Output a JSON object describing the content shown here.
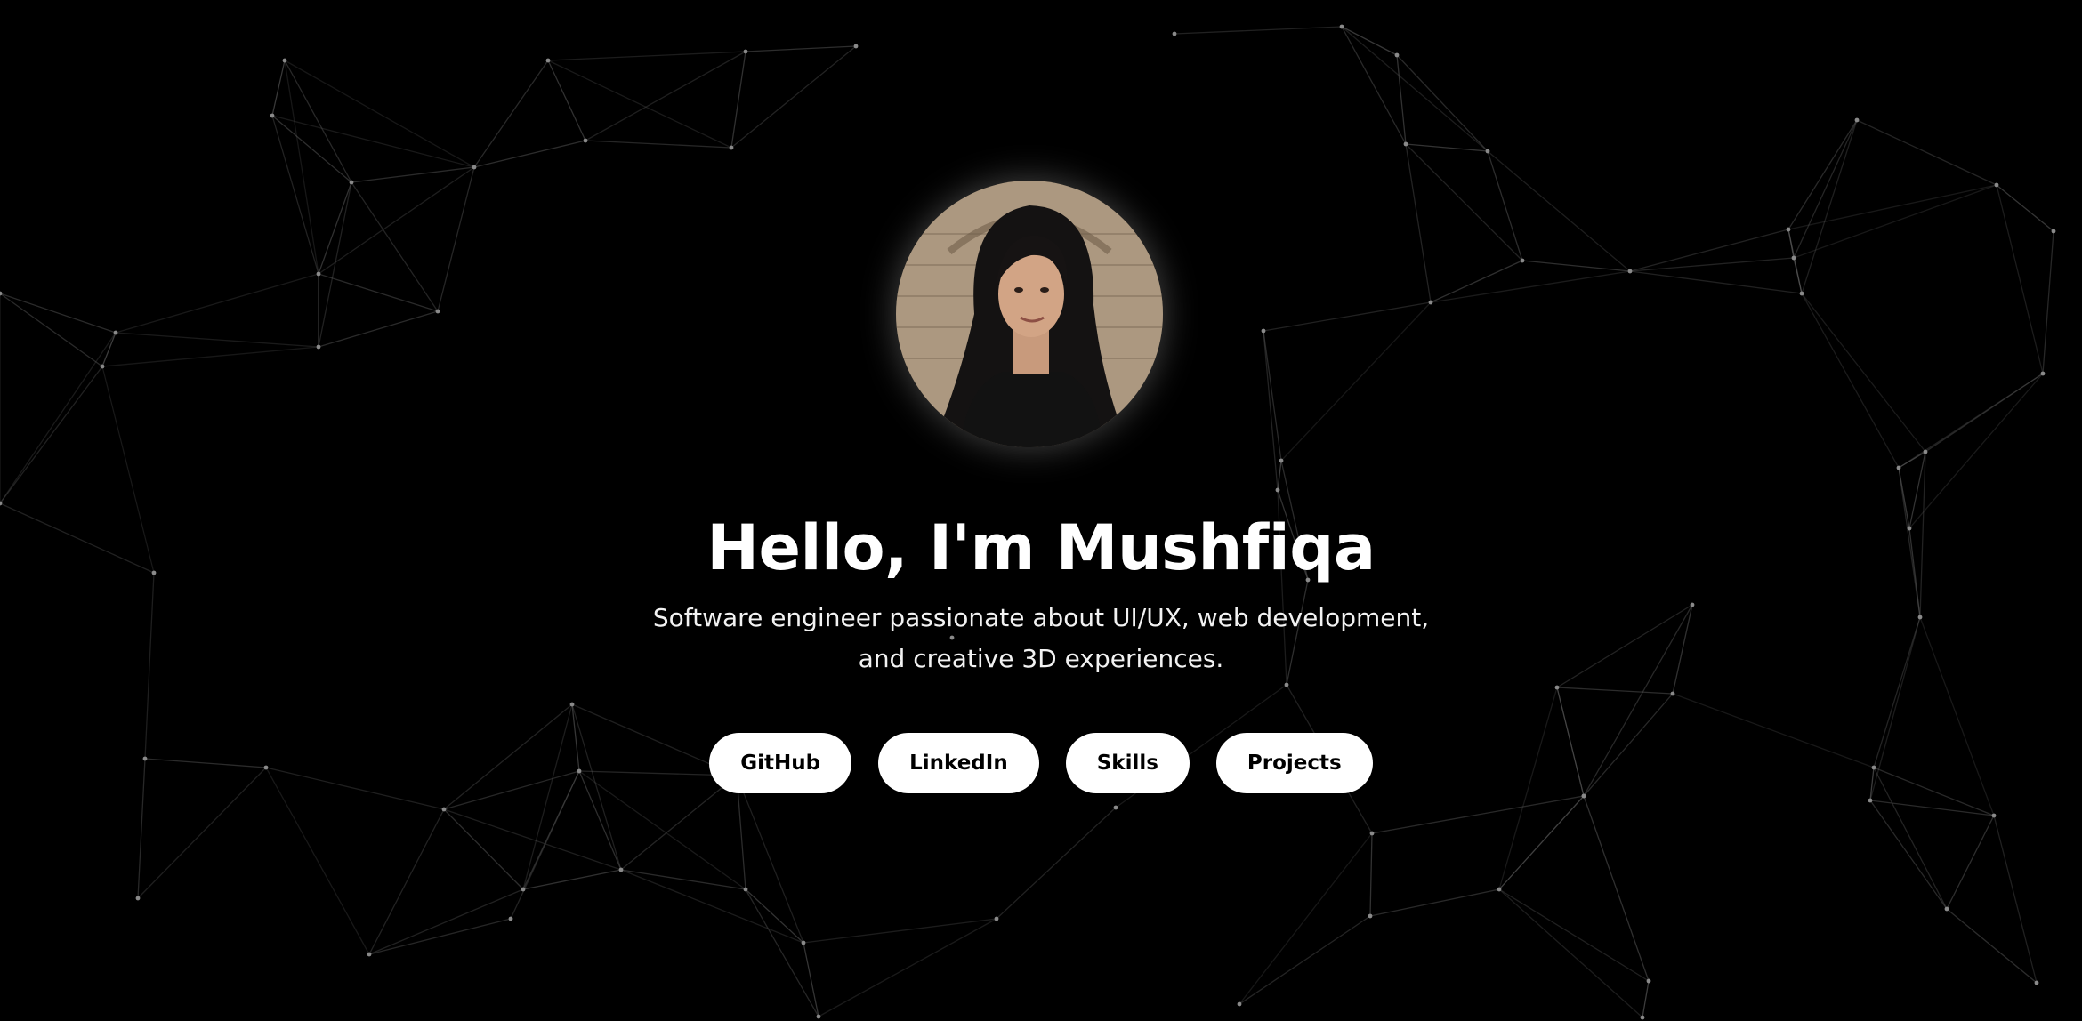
{
  "hero": {
    "title": "Hello, I'm Mushfiqa",
    "subtitle": "Software engineer passionate about UI/UX, web development, and creative 3D experiences.",
    "avatar_alt": "Mushfiqa profile photo"
  },
  "nav_buttons": [
    {
      "label": "GitHub"
    },
    {
      "label": "LinkedIn"
    },
    {
      "label": "Skills"
    },
    {
      "label": "Projects"
    }
  ],
  "colors": {
    "background": "#000000",
    "text": "#ffffff",
    "button_bg": "#ffffff",
    "button_text": "#000000",
    "network_line": "#5a5a5a",
    "network_node": "#8a8a8a"
  }
}
